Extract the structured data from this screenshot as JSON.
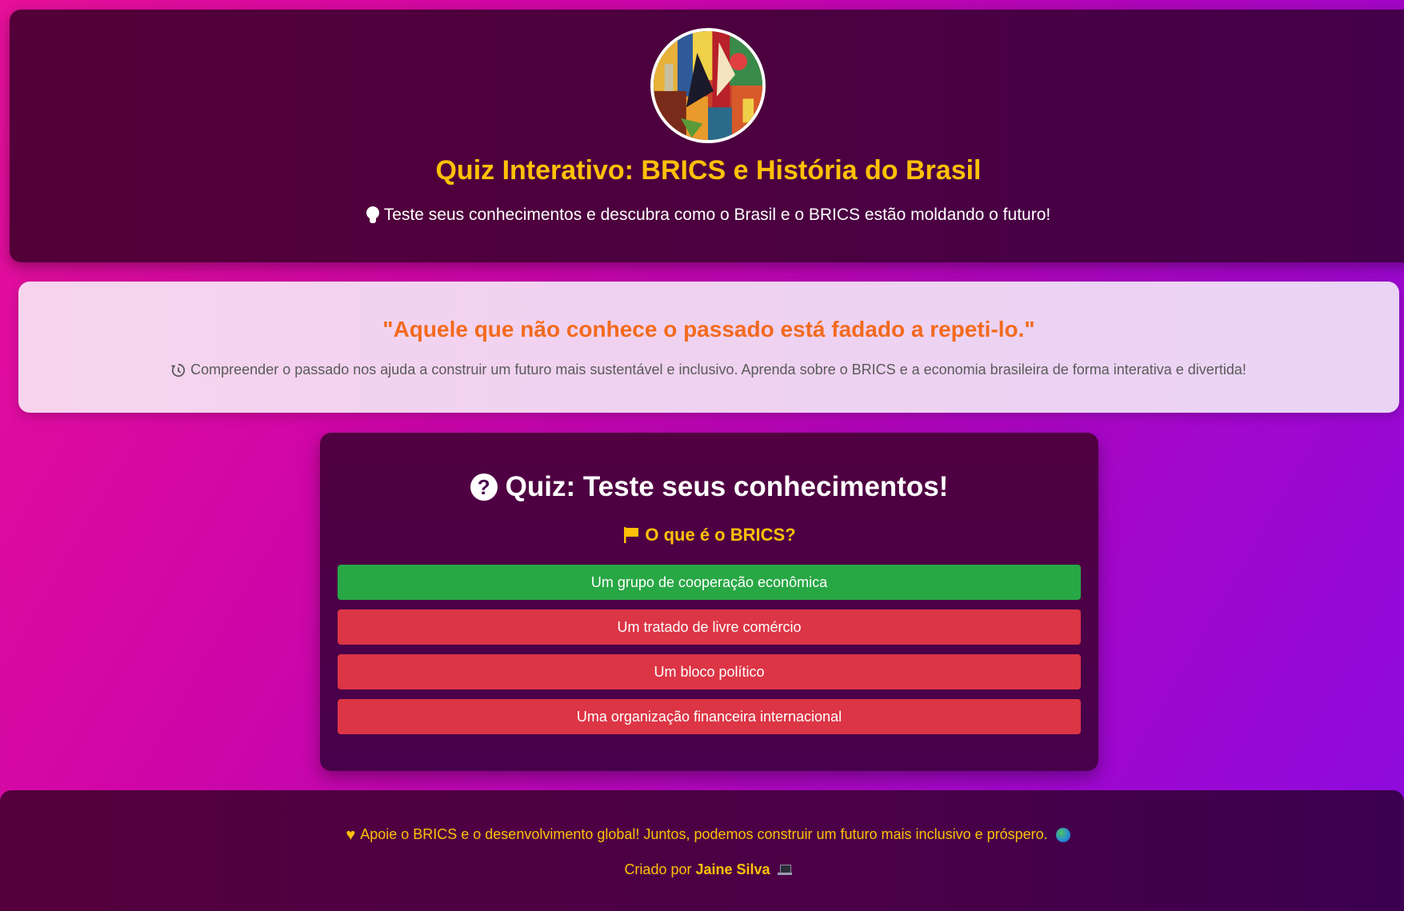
{
  "header": {
    "title": "Quiz Interativo: BRICS e História do Brasil",
    "subtitle": "Teste seus conhecimentos e descubra como o Brasil e o BRICS estão moldando o futuro!",
    "subtitle_icon": "lightbulb-icon",
    "avatar": "brics-artwork-avatar"
  },
  "quote": {
    "text": "\"Aquele que não conhece o passado está fadado a repeti-lo.\"",
    "description": "Compreender o passado nos ajuda a construir um futuro mais sustentável e inclusivo. Aprenda sobre o BRICS e a economia brasileira de forma interativa e divertida!",
    "icon": "history-icon"
  },
  "quiz": {
    "title": "Quiz: Teste seus conhecimentos!",
    "title_icon": "question-circle-icon",
    "question": "O que é o BRICS?",
    "question_icon": "flag-icon",
    "options": [
      {
        "label": "Um grupo de cooperação econômica",
        "state": "correct"
      },
      {
        "label": "Um tratado de livre comércio",
        "state": "wrong"
      },
      {
        "label": "Um bloco político",
        "state": "wrong"
      },
      {
        "label": "Uma organização financeira internacional",
        "state": "wrong"
      }
    ]
  },
  "footer": {
    "message": "Apoie o BRICS e o desenvolvimento global! Juntos, podemos construir um futuro mais inclusivo e próspero.",
    "created_by": "Criado por",
    "author": "Jaine Silva"
  },
  "colors": {
    "accent": "#ffc107",
    "correct": "#28a745",
    "wrong": "#dc3545",
    "quote": "#f36a1e"
  }
}
